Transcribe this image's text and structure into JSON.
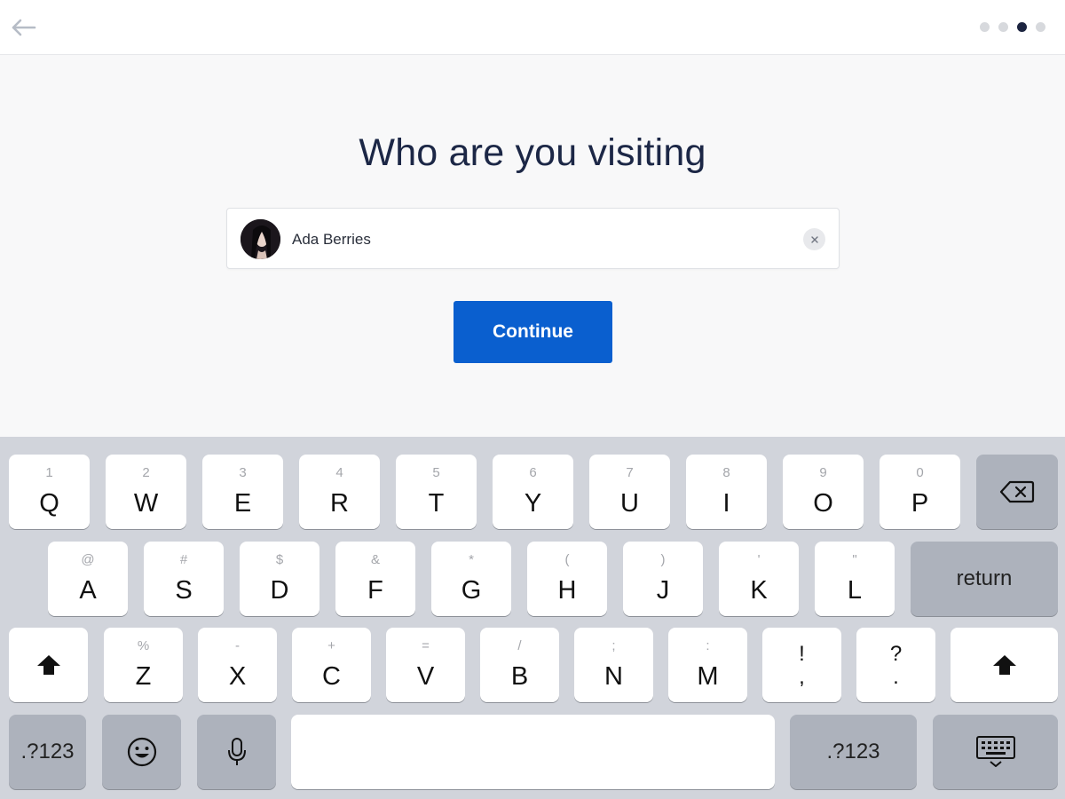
{
  "header": {
    "steps_total": 4,
    "active_step": 3
  },
  "main": {
    "title": "Who are you visiting",
    "host_field": {
      "value": "Ada Berries"
    },
    "continue_label": "Continue"
  },
  "colors": {
    "primary": "#0a5fcf",
    "title": "#1c2746",
    "active_dot": "#1c2440",
    "inactive_dot": "#d7d9dd"
  },
  "keyboard": {
    "row1": [
      {
        "main": "Q",
        "sub": "1"
      },
      {
        "main": "W",
        "sub": "2"
      },
      {
        "main": "E",
        "sub": "3"
      },
      {
        "main": "R",
        "sub": "4"
      },
      {
        "main": "T",
        "sub": "5"
      },
      {
        "main": "Y",
        "sub": "6"
      },
      {
        "main": "U",
        "sub": "7"
      },
      {
        "main": "I",
        "sub": "8"
      },
      {
        "main": "O",
        "sub": "9"
      },
      {
        "main": "P",
        "sub": "0"
      }
    ],
    "row2": [
      {
        "main": "A",
        "sub": "@"
      },
      {
        "main": "S",
        "sub": "#"
      },
      {
        "main": "D",
        "sub": "$"
      },
      {
        "main": "F",
        "sub": "&"
      },
      {
        "main": "G",
        "sub": "*"
      },
      {
        "main": "H",
        "sub": "("
      },
      {
        "main": "J",
        "sub": ")"
      },
      {
        "main": "K",
        "sub": "'"
      },
      {
        "main": "L",
        "sub": "\""
      }
    ],
    "row3": [
      {
        "main": "Z",
        "sub": "%"
      },
      {
        "main": "X",
        "sub": "-"
      },
      {
        "main": "C",
        "sub": "+"
      },
      {
        "main": "V",
        "sub": "="
      },
      {
        "main": "B",
        "sub": "/"
      },
      {
        "main": "N",
        "sub": ";"
      },
      {
        "main": "M",
        "sub": ":"
      }
    ],
    "punct1": {
      "top": "!",
      "bottom": ","
    },
    "punct2": {
      "top": "?",
      "bottom": "."
    },
    "return_label": "return",
    "numbers_label": ".?123",
    "icons": {
      "back": "arrow-left-icon",
      "delete": "backspace-icon",
      "shift": "shift-arrow-icon",
      "emoji": "emoji-icon",
      "mic": "microphone-icon",
      "hide": "keyboard-dismiss-icon",
      "clear": "close-icon"
    }
  }
}
